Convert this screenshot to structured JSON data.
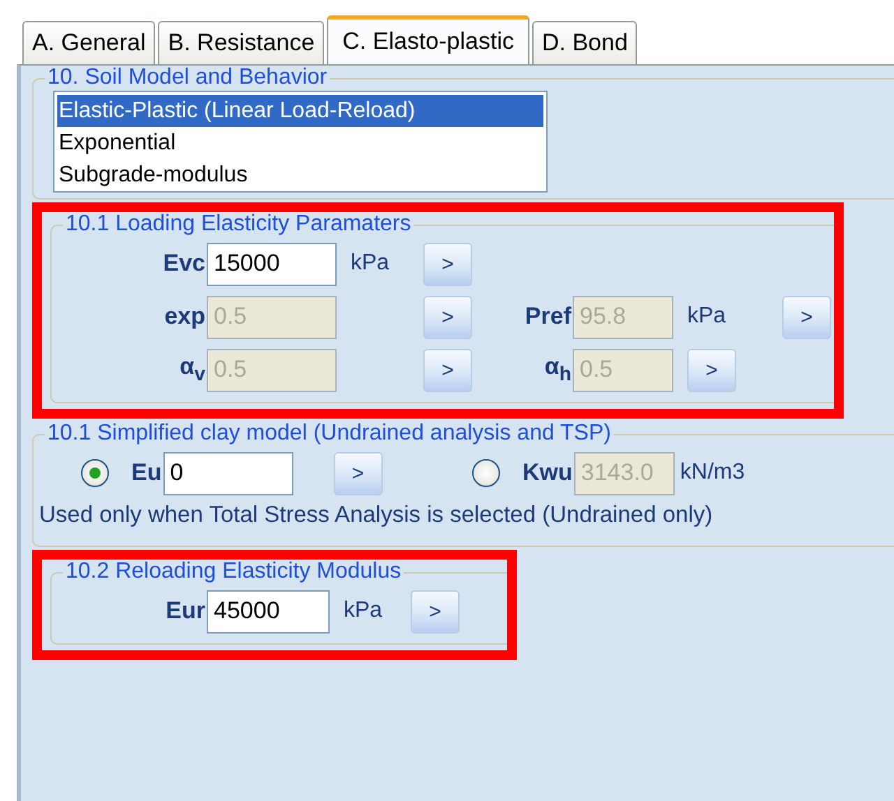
{
  "tabs": [
    {
      "label": "A. General",
      "selected": false
    },
    {
      "label": "B. Resistance",
      "selected": false
    },
    {
      "label": "C. Elasto-plastic",
      "selected": true
    },
    {
      "label": "D. Bond",
      "selected": false
    }
  ],
  "soil_model": {
    "title": "10. Soil Model and Behavior",
    "options": [
      {
        "label": "Elastic-Plastic (Linear Load-Reload)",
        "selected": true
      },
      {
        "label": "Exponential",
        "selected": false
      },
      {
        "label": "Subgrade-modulus",
        "selected": false
      }
    ]
  },
  "loading": {
    "title": "10.1 Loading Elasticity Paramaters",
    "highlighted": true,
    "rows": [
      [
        {
          "label": "Evc",
          "value": "15000",
          "unit": "kPa",
          "disabled": false,
          "button": ">"
        }
      ],
      [
        {
          "label": "exp",
          "value": "0.5",
          "disabled": true,
          "button": ">"
        },
        {
          "label": "Pref",
          "value": "95.8",
          "unit": "kPa",
          "disabled": true,
          "button": ">"
        }
      ],
      [
        {
          "label": "α$_{v}$",
          "value": "0.5",
          "disabled": true,
          "button": ">"
        },
        {
          "label": "α$_{h}$",
          "value": "0.5",
          "disabled": true,
          "button": ">"
        }
      ]
    ]
  },
  "clay": {
    "title": "10.1 Simplified clay model (Undrained analysis and TSP)",
    "options": [
      {
        "label": "Eu",
        "value": "0",
        "disabled": false,
        "selected": true,
        "button": ">"
      },
      {
        "label": "Kwu",
        "value": "3143.0",
        "unit": "kN/m3",
        "disabled": true,
        "selected": false
      }
    ],
    "note": "Used only when Total Stress Analysis is selected (Undrained only)"
  },
  "reload": {
    "title": "10.2 Reloading Elasticity Modulus",
    "highlighted": true,
    "field": {
      "label": "Eur",
      "value": "45000",
      "unit": "kPa",
      "disabled": false,
      "button": ">"
    }
  }
}
